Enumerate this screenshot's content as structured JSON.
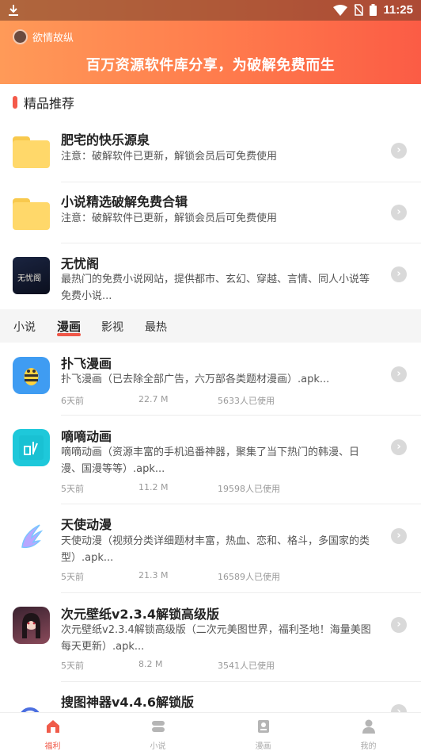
{
  "statusbar": {
    "time": "11:25"
  },
  "header": {
    "app_name": "欲情故纵",
    "slogan": "百万资源软件库分享，为破解免费而生"
  },
  "featured": {
    "title": "精品推荐",
    "items": [
      {
        "title": "肥宅的快乐源泉",
        "desc": "注意：破解软件已更新，解锁会员后可免费使用",
        "icon": "folder-icon"
      },
      {
        "title": "小说精选破解免费合辑",
        "desc": "注意：破解软件已更新，解锁会员后可免费使用",
        "icon": "folder-icon"
      },
      {
        "title": "无忧阁",
        "desc": "最热门的免费小说网站，提供都市、玄幻、穿越、言情、同人小说等免费小说...",
        "icon": "book-icon",
        "icon_text": "无忧阁"
      }
    ]
  },
  "tabs": [
    {
      "label": "小说"
    },
    {
      "label": "漫画",
      "active": true
    },
    {
      "label": "影视"
    },
    {
      "label": "最热"
    }
  ],
  "list": [
    {
      "name": "扑飞漫画",
      "intro": "扑飞漫画（已去除全部广告，六万部各类题材漫画）.apk...",
      "date": "6天前",
      "size": "22.7 M",
      "users": "5633人已使用",
      "icon": "bee-icon"
    },
    {
      "name": "嘀嘀动画",
      "intro": "嘀嘀动画（资源丰富的手机追番神器，聚集了当下热门的韩漫、日漫、国漫等等）.apk...",
      "date": "5天前",
      "size": "11.2 M",
      "users": "19598人已使用",
      "icon": "di-icon"
    },
    {
      "name": "天使动漫",
      "intro": "天使动漫（视频分类详细题材丰富，热血、恋和、格斗，多国家的类型）.apk...",
      "date": "5天前",
      "size": "21.3 M",
      "users": "16589人已使用",
      "icon": "wing-icon"
    },
    {
      "name": "次元壁纸v2.3.4解锁高级版",
      "intro": "次元壁纸v2.3.4解锁高级版（二次元美图世界，福利圣地！海量美图每天更新）.apk...",
      "date": "5天前",
      "size": "8.2 M",
      "users": "3541人已使用",
      "icon": "anime-girl-icon"
    },
    {
      "name": "搜图神器v4.4.6解锁版",
      "intro": "",
      "icon": "search-picture-icon"
    }
  ],
  "bottom_nav": [
    {
      "label": "福利",
      "icon": "home-icon",
      "active": true
    },
    {
      "label": "小说",
      "icon": "book-stack-icon"
    },
    {
      "label": "漫画",
      "icon": "comic-icon"
    },
    {
      "label": "我的",
      "icon": "user-icon"
    }
  ],
  "colors": {
    "accent": "#f05b4a",
    "header_start": "#ff9a58",
    "header_end": "#fb5c45"
  }
}
